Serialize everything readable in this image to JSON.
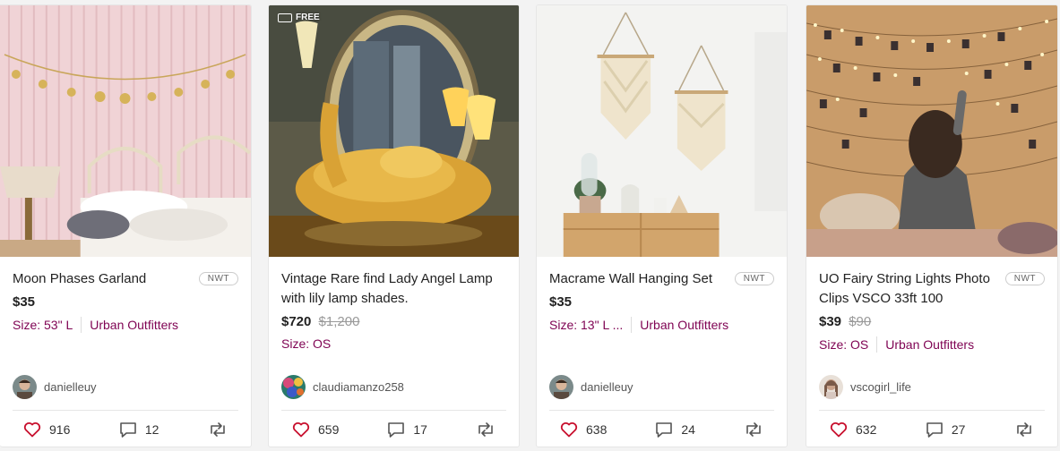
{
  "listings": [
    {
      "title": "Moon Phases Garland",
      "condition": "NWT",
      "price": "$35",
      "original_price": "",
      "size": "Size: 53\" L",
      "brand": "Urban Outfitters",
      "seller": "danielleuy",
      "likes": "916",
      "comments": "12"
    },
    {
      "title": "Vintage Rare find Lady Angel Lamp with lily lamp shades.",
      "condition": "",
      "badge": "FREE",
      "price": "$720",
      "original_price": "$1,200",
      "size": "Size: OS",
      "brand": "",
      "seller": "claudiamanzo258",
      "likes": "659",
      "comments": "17"
    },
    {
      "title": "Macrame Wall Hanging Set",
      "condition": "NWT",
      "price": "$35",
      "original_price": "",
      "size": "Size: 13\" L ...",
      "brand": "Urban Outfitters",
      "seller": "danielleuy",
      "likes": "638",
      "comments": "24"
    },
    {
      "title": "UO Fairy String Lights Photo Clips VSCO 33ft 100",
      "condition": "NWT",
      "price": "$39",
      "original_price": "$90",
      "size": "Size: OS",
      "brand": "Urban Outfitters",
      "seller": "vscogirl_life",
      "likes": "632",
      "comments": "27"
    }
  ],
  "icons": {
    "like": "heart-icon",
    "comment": "comment-icon",
    "share": "share-icon",
    "shipping": "truck-icon"
  },
  "colors": {
    "accent": "#7f0353",
    "like": "#c8102e"
  }
}
